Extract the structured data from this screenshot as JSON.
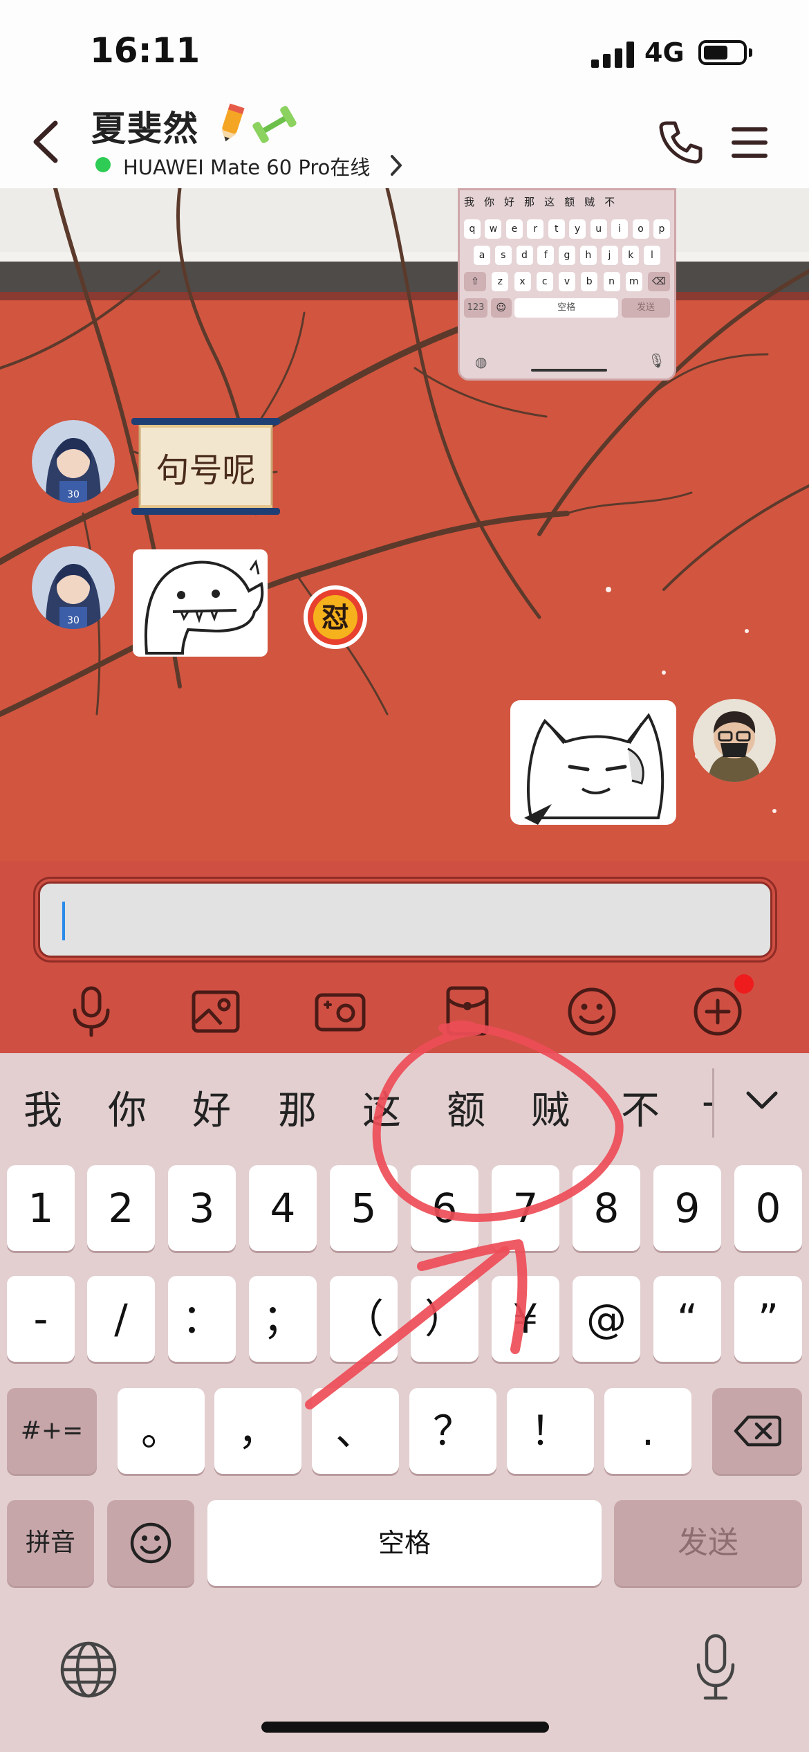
{
  "status_bar": {
    "time": "16:11",
    "network": "4G"
  },
  "header": {
    "contact_name": "夏斐然",
    "emoji_badges": [
      "pencil-icon",
      "dumbbell-icon"
    ],
    "device_status": "HUAWEI Mate 60 Pro在线",
    "online_color": "#2ecc55"
  },
  "mini_keyboard": {
    "candidates": [
      "我",
      "你",
      "好",
      "那",
      "这",
      "额",
      "贼",
      "不"
    ],
    "row1": [
      "q",
      "w",
      "e",
      "r",
      "t",
      "y",
      "u",
      "i",
      "o",
      "p"
    ],
    "row2": [
      "a",
      "s",
      "d",
      "f",
      "g",
      "h",
      "j",
      "k",
      "l"
    ],
    "row3": [
      "z",
      "x",
      "c",
      "v",
      "b",
      "n",
      "m"
    ],
    "mode_label": "123",
    "space_label": "空格",
    "send_label": "发送"
  },
  "messages": [
    {
      "side": "left",
      "type": "sticker",
      "sticker_text": "句号呢"
    },
    {
      "side": "left",
      "type": "sticker",
      "description_icon": "dinosaur-sticker-icon",
      "reaction": "怼"
    },
    {
      "side": "right",
      "type": "sticker",
      "description_icon": "cat-sticker-icon"
    }
  ],
  "input": {
    "value": "",
    "placeholder": ""
  },
  "toolbar": [
    "mic-icon",
    "image-icon",
    "camera-icon",
    "red-packet-icon",
    "emoji-icon",
    "plus-icon"
  ],
  "keyboard": {
    "candidates": [
      "我",
      "你",
      "好",
      "那",
      "这",
      "额",
      "贼",
      "不",
      "-"
    ],
    "row_numbers": [
      "1",
      "2",
      "3",
      "4",
      "5",
      "6",
      "7",
      "8",
      "9",
      "0"
    ],
    "row_symbols": [
      "-",
      "/",
      "：",
      "；",
      "（",
      "）",
      "¥",
      "@",
      "“",
      "”"
    ],
    "row_punct": [
      "。",
      "，",
      "、",
      "？",
      "！",
      "."
    ],
    "symbols_toggle": "#+=",
    "pinyin_label": "拼音",
    "space_label": "空格",
    "send_label": "发送"
  },
  "colors": {
    "accent_red": "#cf4f43",
    "keyboard_bg": "#e3cfd0",
    "annotation": "#ee4d57"
  }
}
